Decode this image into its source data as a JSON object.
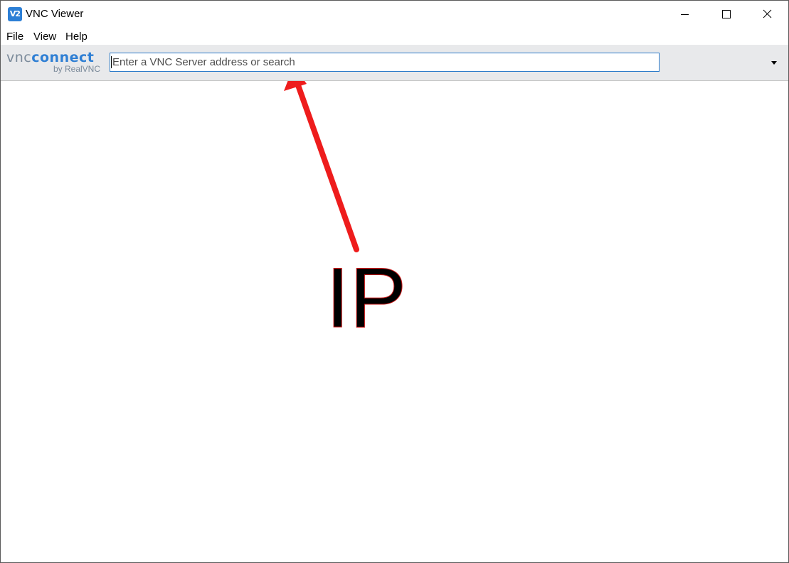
{
  "window": {
    "title": "VNC Viewer",
    "app_icon_text": "V2",
    "icons": {
      "minimize": "minimize-icon",
      "maximize": "maximize-icon",
      "close": "close-icon",
      "dropdown": "chevron-down-icon"
    }
  },
  "menu": {
    "items": [
      {
        "label": "File"
      },
      {
        "label": "View"
      },
      {
        "label": "Help"
      }
    ]
  },
  "toolbar": {
    "logo_vnc": "vnc",
    "logo_connect": "connect",
    "logo_sub": "by RealVNC",
    "search": {
      "placeholder": "Enter a VNC Server address or search",
      "value": ""
    }
  },
  "annotation": {
    "label": "IP",
    "color": "#ee1c1c"
  },
  "colors": {
    "accent": "#2c7bc9",
    "toolbar_bg": "#e8e9eb",
    "logo_blue": "#2f7fd4",
    "logo_gray": "#7b8a9a"
  }
}
